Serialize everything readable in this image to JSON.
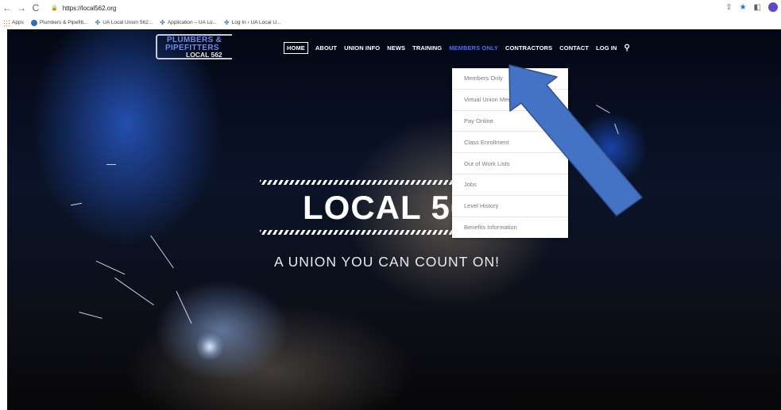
{
  "browser": {
    "url": "https://local562.org",
    "bookmarks": [
      {
        "label": "Apps",
        "icon": "apps-grid-icon"
      },
      {
        "label": "Plumbers & Pipefitt...",
        "icon": "site-favicon"
      },
      {
        "label": "UA Local Union 562...",
        "icon": "ua-favicon"
      },
      {
        "label": "Application – UA Lo...",
        "icon": "ua-favicon"
      },
      {
        "label": "Log In ‹ UA Local U...",
        "icon": "ua-favicon"
      }
    ]
  },
  "site": {
    "logo": {
      "line1": "PLUMBERS &",
      "line2": "PIPEFITTERS",
      "line3": "LOCAL 562"
    },
    "nav": {
      "home": "HOME",
      "about": "ABOUT",
      "union_info": "UNION INFO",
      "news": "NEWS",
      "training": "TRAINING",
      "members_only": "MEMBERS ONLY",
      "contractors": "CONTRACTORS",
      "contact": "CONTACT",
      "login": "LOG IN"
    },
    "dropdown": [
      "Members Only",
      "Virtual Union Meeting",
      "Pay Online",
      "Class Enrollment",
      "Out of Work Lists",
      "Jobs",
      "Level History",
      "Benefits Information"
    ],
    "hero": {
      "title": "LOCAL 562",
      "subtitle": "A UNION YOU CAN COUNT ON!"
    }
  },
  "colors": {
    "nav_active": "#4b6ef5",
    "annotation_arrow": "#4472c4",
    "logo_blue": "#6d8cf0"
  }
}
